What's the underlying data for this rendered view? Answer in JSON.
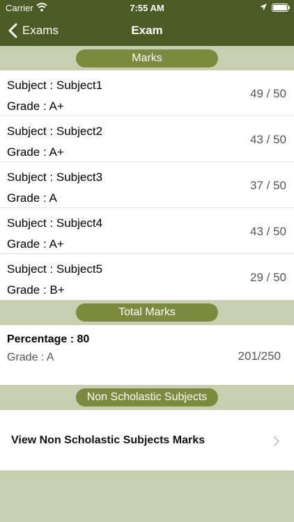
{
  "status_bar": {
    "carrier": "Carrier",
    "time": "7:55 AM"
  },
  "nav": {
    "back_label": "Exams",
    "title": "Exam"
  },
  "marks_section": {
    "title": "Marks",
    "rows": [
      {
        "subject": "Subject : Subject1",
        "grade": "Grade : A+",
        "score": "49 / 50"
      },
      {
        "subject": "Subject : Subject2",
        "grade": "Grade : A+",
        "score": "43 / 50"
      },
      {
        "subject": "Subject : Subject3",
        "grade": "Grade : A",
        "score": "37 / 50"
      },
      {
        "subject": "Subject : Subject4",
        "grade": "Grade : A+",
        "score": "43 / 50"
      },
      {
        "subject": "Subject : Subject5",
        "grade": "Grade : B+",
        "score": "29 / 50"
      }
    ]
  },
  "total_section": {
    "title": "Total Marks",
    "percentage": "Percentage : 80",
    "grade": "Grade : A",
    "score": "201/250"
  },
  "non_scholastic": {
    "title": "Non Scholastic Subjects",
    "link_label": "View Non Scholastic Subjects Marks"
  },
  "icons": {
    "wifi": "wifi-icon",
    "location": "location-arrow-icon",
    "battery": "battery-icon",
    "back": "chevron-left-icon",
    "disclosure": "chevron-right-icon"
  },
  "colors": {
    "nav_bar": "#4c5a24",
    "pill": "#7b8a3e",
    "background": "#c8cfb1"
  }
}
